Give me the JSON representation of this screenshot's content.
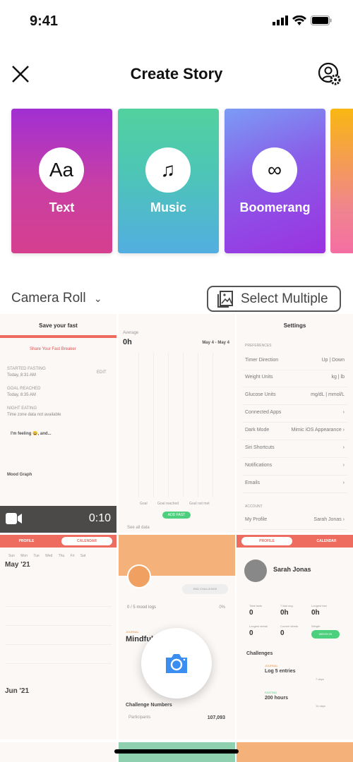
{
  "status": {
    "time": "9:41"
  },
  "header": {
    "title": "Create Story",
    "close_icon": "close-icon",
    "settings_icon": "person-gear-icon"
  },
  "cards": [
    {
      "label": "Text",
      "icon_text": "Aa",
      "gradient": [
        "#a12fd2",
        "#d63f8e"
      ]
    },
    {
      "label": "Music",
      "icon_text": "♫",
      "gradient": [
        "#52d19e",
        "#52aee0"
      ]
    },
    {
      "label": "Boomerang",
      "icon_text": "∞",
      "gradient": [
        "#7b9cf5",
        "#9b32e0"
      ]
    }
  ],
  "camera_roll": {
    "label": "Camera Roll",
    "select_multiple": "Select Multiple"
  },
  "thumbs": {
    "save_fast": {
      "title": "Save your fast",
      "share": "Share Your Fast Breaker",
      "started_label": "STARTED FASTING",
      "started": "Today, 8:31 AM",
      "goal_label": "GOAL REACHED",
      "goal": "Today, 8:35 AM",
      "night_label": "NIGHT EATING",
      "night": "Time zone data not available",
      "edit": "EDIT",
      "feeling": "I'm feeling 😀, and...",
      "mood_graph": "Mood Graph",
      "duration": "0:10"
    },
    "chart": {
      "average": "Average",
      "value": "0h",
      "range": "May 4 - May 4",
      "legend": [
        "Goal",
        "Goal reached",
        "Goal not met"
      ],
      "add_fast": "ADD FAST",
      "see_all": "See all data"
    },
    "settings": {
      "title": "Settings",
      "preferences": "PREFERENCES",
      "rows": [
        {
          "label": "Timer Direction",
          "value": "Up | Down"
        },
        {
          "label": "Weight Units",
          "value": "kg | lb"
        },
        {
          "label": "Glucose Units",
          "value": "mg/dL | mmol/L"
        },
        {
          "label": "Connected Apps",
          "value": "›"
        },
        {
          "label": "Dark Mode",
          "value": "Mimic iOS Appearance ›"
        },
        {
          "label": "Siri Shortcuts",
          "value": "›"
        },
        {
          "label": "Notifications",
          "value": "›"
        },
        {
          "label": "Emails",
          "value": "›"
        }
      ],
      "account": "ACCOUNT",
      "profile_label": "My Profile",
      "profile_value": "Sarah Jonas ›"
    },
    "calendar": {
      "tabs": [
        "PROFILE",
        "CALENDAR"
      ],
      "days": [
        "Sun",
        "Mon",
        "Tue",
        "Wed",
        "Thu",
        "Fri",
        "Sat"
      ],
      "months": [
        "May '21",
        "Jun '21"
      ]
    },
    "challenge": {
      "end": "END CHALLENGE",
      "mood": "0 / 5 mood logs",
      "pct": "0%",
      "journal": "JOURNAL",
      "title": "Mindful",
      "numbers": "Challenge Numbers",
      "participants_label": "Participants",
      "participants": "107,093"
    },
    "profile": {
      "tabs": [
        "PROFILE",
        "CALENDAR"
      ],
      "name": "Sarah Jonas",
      "stats": [
        {
          "label": "Total fasts",
          "value": "0"
        },
        {
          "label": "7-fast avg.",
          "value": "0h"
        },
        {
          "label": "Longest fast",
          "value": "0h"
        },
        {
          "label": "Longest streak",
          "value": "0"
        },
        {
          "label": "Current streak",
          "value": "0"
        },
        {
          "label": "Weight",
          "value": "WEIGH IN"
        }
      ],
      "challenges": "Challenges",
      "items": [
        {
          "tag": "JOURNAL",
          "title": "Log 5 entries",
          "days": "7 days"
        },
        {
          "tag": "FASTING",
          "title": "200 hours",
          "days": "14 days"
        }
      ]
    }
  }
}
